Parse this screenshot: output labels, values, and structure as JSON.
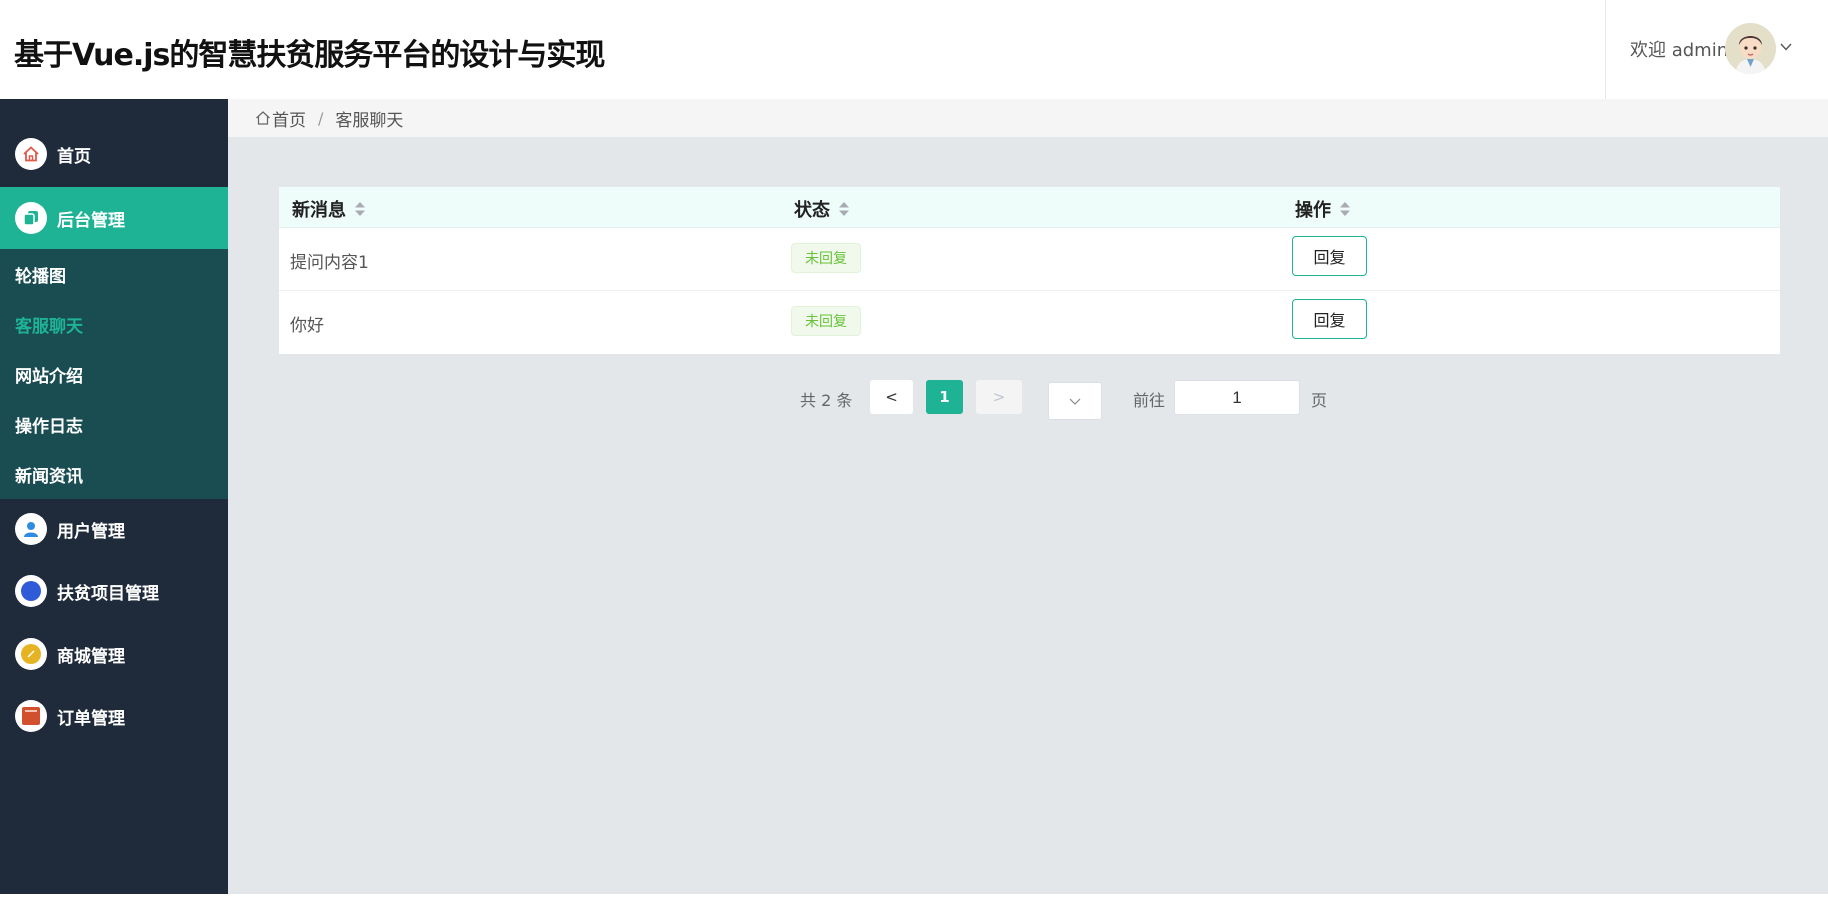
{
  "header": {
    "title": "基于Vue.js的智慧扶贫服务平台的设计与实现",
    "welcome": "欢迎 admin"
  },
  "sidebar": {
    "items": [
      {
        "label": "首页",
        "icon": "home-icon"
      },
      {
        "label": "后台管理",
        "icon": "copy-icon",
        "active": true
      },
      {
        "label": "用户管理",
        "icon": "user-icon"
      },
      {
        "label": "扶贫项目管理",
        "icon": "compass-icon"
      },
      {
        "label": "商城管理",
        "icon": "coin-icon"
      },
      {
        "label": "订单管理",
        "icon": "book-icon"
      }
    ],
    "submenu": [
      "轮播图",
      "客服聊天",
      "网站介绍",
      "操作日志",
      "新闻资讯"
    ]
  },
  "breadcrumb": {
    "home": "首页",
    "separator": "/",
    "current": "客服聊天"
  },
  "table": {
    "headers": [
      "新消息",
      "状态",
      "操作"
    ],
    "rows": [
      {
        "message": "提问内容1",
        "status": "未回复",
        "action": "回复"
      },
      {
        "message": "你好",
        "status": "未回复",
        "action": "回复"
      }
    ]
  },
  "pagination": {
    "total": "共 2 条",
    "prev": "<",
    "current_page": "1",
    "next": ">",
    "goto_label": "前往",
    "goto_value": "1",
    "page_label": "页"
  },
  "colors": {
    "accent": "#1eb395",
    "sidebar_bg": "#1f2a3a",
    "submenu_bg": "#1a4d52",
    "status_tag": "#67c23a"
  }
}
